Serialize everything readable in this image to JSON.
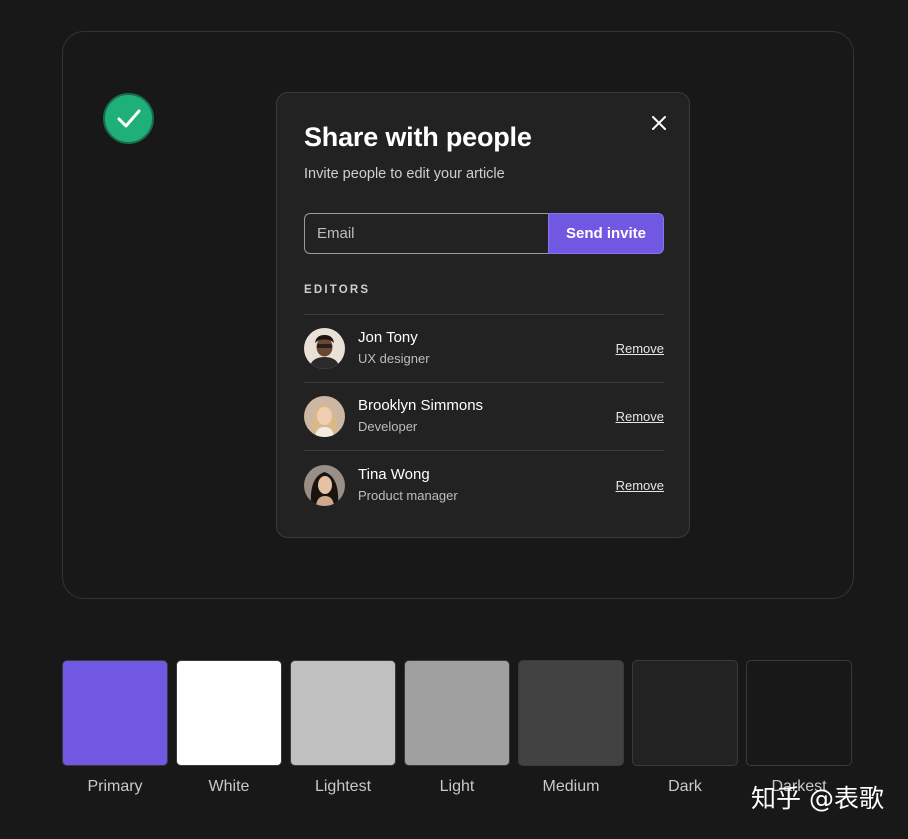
{
  "modal": {
    "title": "Share with people",
    "subtitle": "Invite people to edit your article",
    "email_placeholder": "Email",
    "send_label": "Send invite",
    "section_label": "EDITORS",
    "editors": [
      {
        "name": "Jon Tony",
        "role": "UX designer",
        "action": "Remove"
      },
      {
        "name": "Brooklyn Simmons",
        "role": "Developer",
        "action": "Remove"
      },
      {
        "name": "Tina Wong",
        "role": "Product manager",
        "action": "Remove"
      }
    ]
  },
  "palette": [
    {
      "label": "Primary",
      "color": "#7158e2"
    },
    {
      "label": "White",
      "color": "#ffffff"
    },
    {
      "label": "Lightest",
      "color": "#c0c0c0"
    },
    {
      "label": "Light",
      "color": "#a0a0a0"
    },
    {
      "label": "Medium",
      "color": "#424242"
    },
    {
      "label": "Dark",
      "color": "#222222"
    },
    {
      "label": "Darkest",
      "color": "#181818"
    }
  ],
  "watermark": "知乎 @表歌",
  "colors": {
    "accent": "#7158e2",
    "success": "#1fb07a",
    "background": "#181818",
    "surface": "#222222"
  },
  "icons": {
    "success": "check-circle-icon",
    "close": "close-icon"
  }
}
